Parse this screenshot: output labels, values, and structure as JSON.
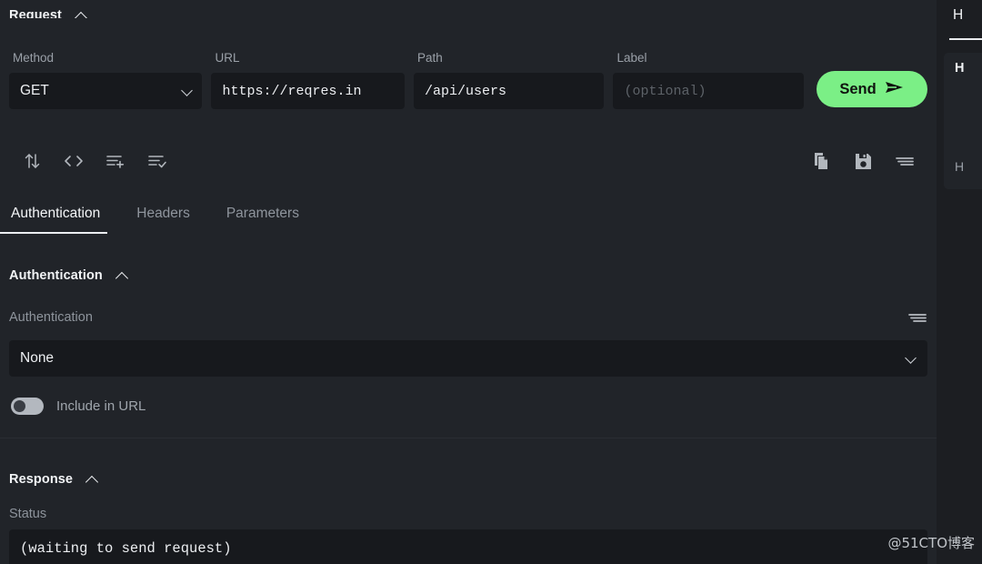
{
  "request": {
    "section_title": "Request",
    "collapse_icon": "chevron-up-icon",
    "method": {
      "label": "Method",
      "value": "GET",
      "caret_icon": "chevron-down-icon"
    },
    "url": {
      "label": "URL",
      "value": "https://reqres.in"
    },
    "path": {
      "label": "Path",
      "value": "/api/users"
    },
    "label_field": {
      "label": "Label",
      "value": "",
      "placeholder": "(optional)"
    },
    "send_button": {
      "label": "Send",
      "icon": "send-plane-icon",
      "color": "#7bef86"
    },
    "toolbar_left": [
      {
        "name": "swap-arrows-icon",
        "title": "Swap"
      },
      {
        "name": "code-brackets-icon",
        "title": "Code"
      },
      {
        "name": "list-add-icon",
        "title": "Add to list"
      },
      {
        "name": "list-check-icon",
        "title": "Check list"
      }
    ],
    "toolbar_right": [
      {
        "name": "copy-icon",
        "title": "Copy"
      },
      {
        "name": "save-floppy-icon",
        "title": "Save"
      },
      {
        "name": "menu-lines-icon",
        "title": "Menu"
      }
    ]
  },
  "tabs": [
    {
      "label": "Authentication",
      "active": true
    },
    {
      "label": "Headers",
      "active": false
    },
    {
      "label": "Parameters",
      "active": false
    }
  ],
  "authentication": {
    "section_title": "Authentication",
    "collapse_icon": "chevron-up-icon",
    "field_label": "Authentication",
    "row_menu_icon": "menu-lines-icon",
    "selected_type": "None",
    "caret_icon": "chevron-down-icon",
    "include_in_url": {
      "label": "Include in URL",
      "enabled": false
    }
  },
  "response": {
    "section_title": "Response",
    "collapse_icon": "chevron-up-icon",
    "status_label": "Status",
    "status_value": "(waiting to send request)"
  },
  "side_panel": {
    "tab_label": "H",
    "heading": "H",
    "sub_label": "H"
  },
  "watermark": "@51CTO博客",
  "theme": {
    "background": "#1c1e22",
    "panel": "#212429",
    "input": "#17191d",
    "accent": "#7bef86",
    "text": "#e8eaed",
    "muted": "#8e949c"
  }
}
